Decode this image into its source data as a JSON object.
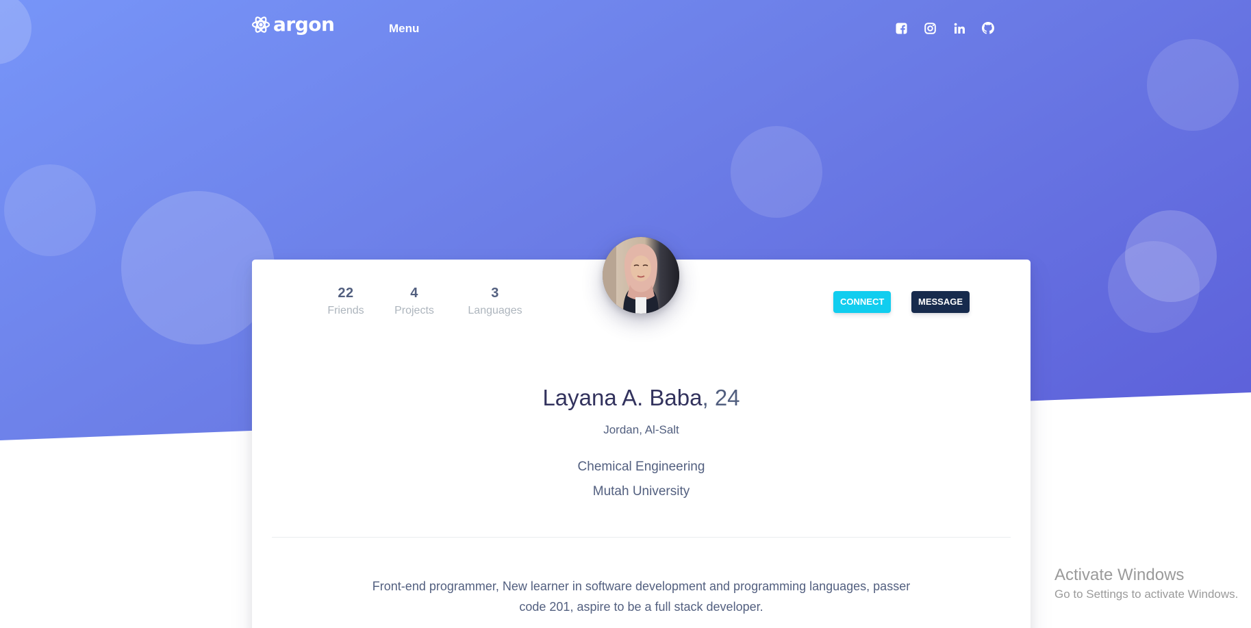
{
  "navbar": {
    "brand": "argon",
    "menu_label": "Menu",
    "social_icons": [
      "facebook-icon",
      "instagram-icon",
      "linkedin-icon",
      "github-icon"
    ]
  },
  "profile": {
    "stats": [
      {
        "value": "22",
        "label": "Friends"
      },
      {
        "value": "4",
        "label": "Projects"
      },
      {
        "value": "3",
        "label": "Languages"
      }
    ],
    "connect_label": "Connect",
    "message_label": "Message",
    "name": "Layana A. Baba",
    "age": ", 24",
    "location": "Jordan, Al-Salt",
    "major": "Chemical Engineering",
    "university": "Mutah University",
    "bio": "Front-end programmer, New learner in software development and programming languages, passer code 201, aspire to be a full stack developer."
  },
  "windows_notice": {
    "title": "Activate Windows",
    "subtitle": "Go to Settings to activate Windows."
  },
  "colors": {
    "hero_start": "#7795f8",
    "hero_end": "#5c5fd9",
    "connect": "#11cdef",
    "message": "#172b4d",
    "heading": "#32325d",
    "text": "#525f7f",
    "muted": "#adb5bd"
  }
}
